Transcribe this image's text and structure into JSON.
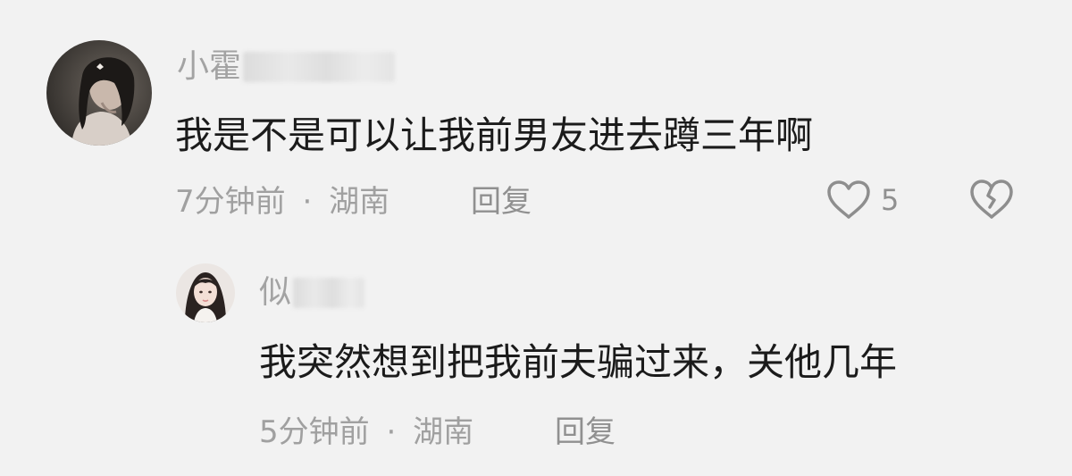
{
  "comments": [
    {
      "username_visible": "小霍",
      "text": "我是不是可以让我前男友进去蹲三年啊",
      "time": "7分钟前",
      "separator": "·",
      "location": "湖南",
      "reply_label": "回复",
      "likes": "5",
      "like_icon": "heart-outline-icon",
      "dislike_icon": "broken-heart-icon"
    }
  ],
  "replies": [
    {
      "username_visible": "似",
      "text": "我突然想到把我前夫骗过来，关他几年",
      "time": "5分钟前",
      "separator": "·",
      "location": "湖南",
      "reply_label": "回复"
    }
  ],
  "colors": {
    "background": "#f2f2f2",
    "text_primary": "#1b1b1b",
    "text_secondary": "#a0a0a0",
    "icon": "#8e8e8e"
  }
}
